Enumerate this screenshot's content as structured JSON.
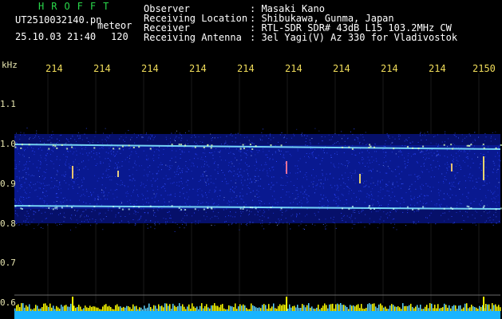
{
  "header": {
    "app_title": "HROFFT",
    "file_name": "UT2510032140.pn",
    "mode_label": "meteor",
    "datetime": "25.10.03 21:40",
    "interval": "120"
  },
  "metadata": {
    "labels": [
      "Observer",
      "Receiving Location",
      "Receiver",
      "Receiving Antenna"
    ],
    "values": [
      ": Masaki Kano",
      ": Shibukawa, Gunma, Japan",
      ": RTL-SDR SDR# 43dB L15 103.2MHz CW",
      ": 3el Yagi(V) Az 330 for Vladivostok"
    ]
  },
  "axes": {
    "y_unit": "kHz",
    "top_ticks": [
      "214",
      "214",
      "214",
      "214",
      "214",
      "214",
      "214",
      "214",
      "214",
      "2150"
    ],
    "y_ticks": [
      "1.1",
      "1.0",
      "0.9",
      "0.8",
      "0.7",
      "0.6"
    ]
  },
  "colors": {
    "background": "#000000",
    "title_green": "#29d84a",
    "tick_yellow": "#f0dc5a",
    "axis_label": "#e8e6b0",
    "noise_blue": "#2a46ff",
    "signal_cyan": "#7fe6ff",
    "bottom_bar_cyan": "#19b4ff",
    "bottom_spike_yellow": "#ffff00"
  }
}
